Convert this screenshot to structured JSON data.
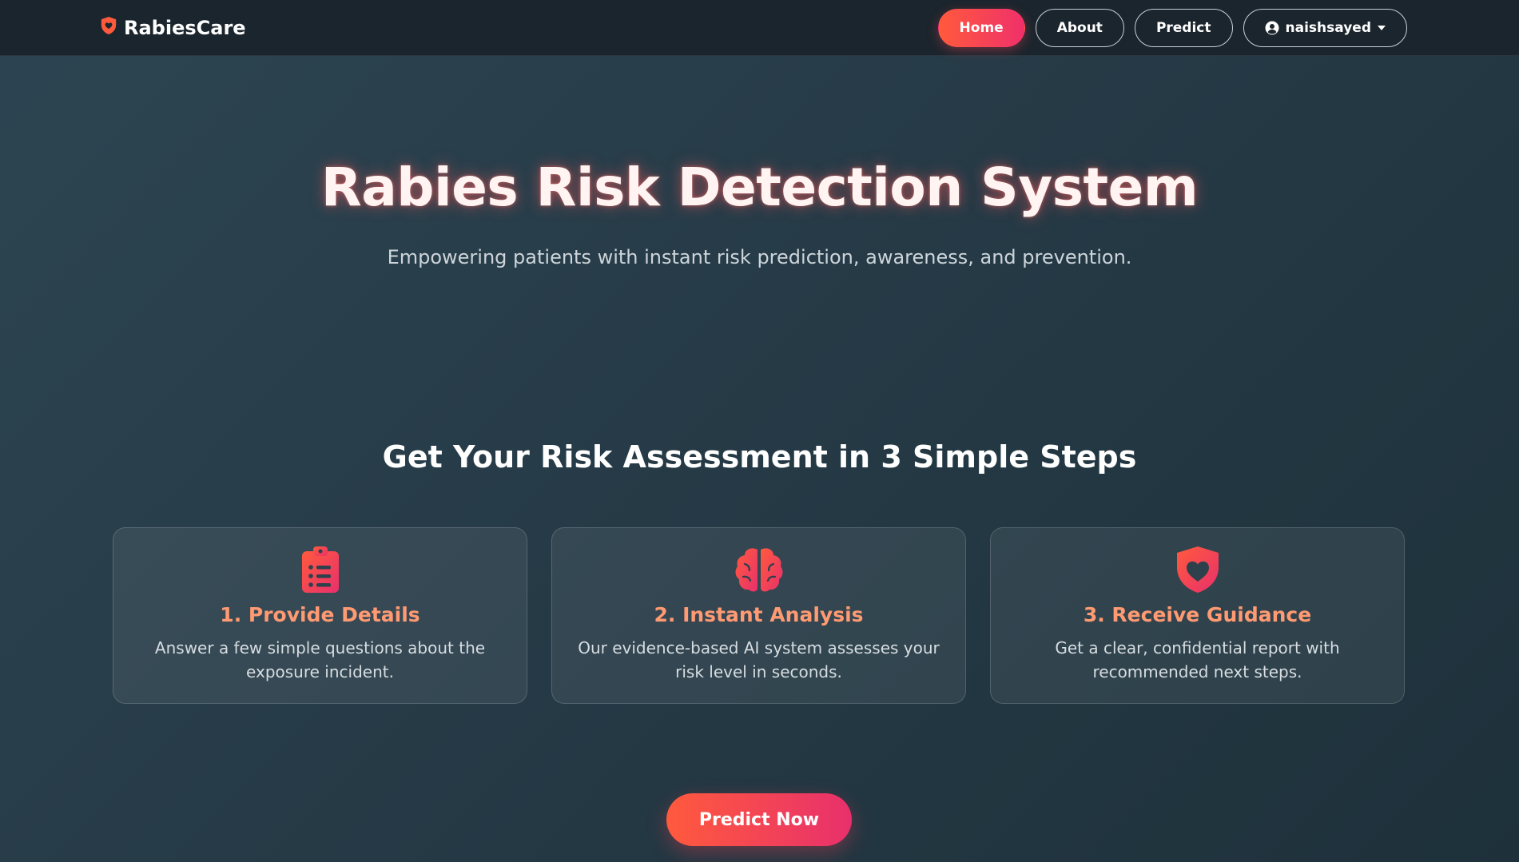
{
  "brand": {
    "name": "RabiesCare",
    "icon": "shield-heart-icon"
  },
  "nav": {
    "home": "Home",
    "about": "About",
    "predict": "Predict",
    "user": "naishsayed"
  },
  "hero": {
    "title": "Rabies Risk Detection System",
    "subtitle": "Empowering patients with instant risk prediction, awareness, and prevention."
  },
  "steps": {
    "title": "Get Your Risk Assessment in 3 Simple Steps",
    "items": [
      {
        "icon": "clipboard-list-icon",
        "title": "1. Provide Details",
        "text": "Answer a few simple questions about the exposure incident."
      },
      {
        "icon": "brain-icon",
        "title": "2. Instant Analysis",
        "text": "Our evidence-based AI system assesses your risk level in seconds."
      },
      {
        "icon": "shield-heart-icon",
        "title": "3. Receive Guidance",
        "text": "Get a clear, confidential report with recommended next steps."
      }
    ]
  },
  "cta": {
    "label": "Predict Now"
  },
  "colors": {
    "accent_start": "#ff5a3d",
    "accent_end": "#f0306a",
    "card_title": "#ff9a72",
    "navbar_bg": "#1b252d"
  }
}
